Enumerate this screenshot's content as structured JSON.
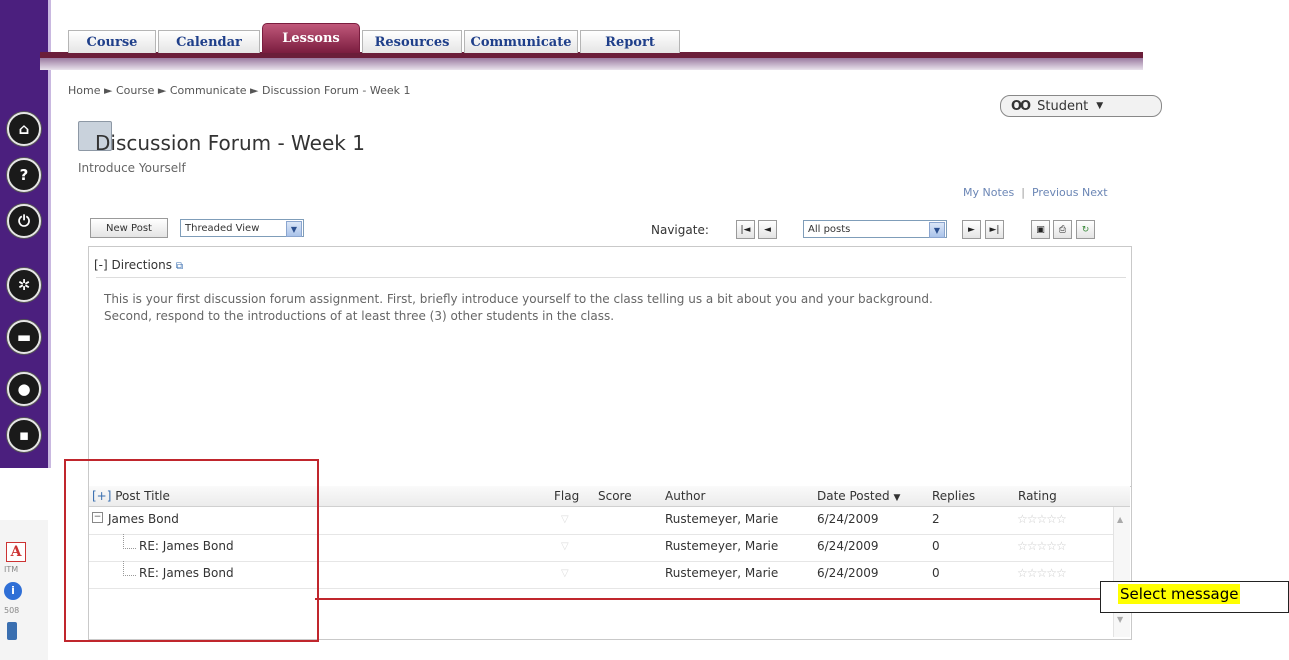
{
  "tabs": [
    "Course",
    "Calendar",
    "Lessons",
    "Resources",
    "Communicate",
    "Report"
  ],
  "active_tab": "Lessons",
  "breadcrumb": [
    "Home",
    "Course",
    "Communicate",
    "Discussion Forum - Week 1"
  ],
  "breadcrumb_sep": "►",
  "role_view": "Student",
  "page": {
    "title": "Discussion Forum - Week 1",
    "subtitle": "Introduce Yourself"
  },
  "top_links": {
    "my_notes": "My Notes",
    "previous": "Previous",
    "next": "Next"
  },
  "toolbar": {
    "new_post": "New Post",
    "view_select": "Threaded View",
    "navigate_label": "Navigate:",
    "filter_select": "All posts"
  },
  "directions": {
    "toggle": "[-] Directions",
    "text": "This is your first discussion forum assignment.  First, briefly introduce yourself to the class telling us a bit about you and your background.  Second, respond to the introductions of at least three (3) other students in the class."
  },
  "grid": {
    "expand_toggle": "[+]",
    "columns": [
      "Post Title",
      "Flag",
      "Score",
      "Author",
      "Date Posted",
      "Replies",
      "Rating"
    ],
    "rows": [
      {
        "title": "James Bond",
        "flag": "",
        "score": "",
        "author": "Rustemeyer, Marie",
        "date": "6/24/2009",
        "replies": "2",
        "level": 0
      },
      {
        "title": "RE: James Bond",
        "flag": "",
        "score": "",
        "author": "Rustemeyer, Marie",
        "date": "6/24/2009",
        "replies": "0",
        "level": 1
      },
      {
        "title": "RE: James Bond",
        "flag": "",
        "score": "",
        "author": "Rustemeyer, Marie",
        "date": "6/24/2009",
        "replies": "0",
        "level": 1
      }
    ]
  },
  "sidebar_bottom": {
    "itm": "ITM",
    "s508": "508"
  },
  "callout": "Select message",
  "colors": {
    "rail": "#4b1f7e",
    "active_tab": "#7a1d3f",
    "annotation_red": "#c0262d",
    "highlight": "#ffff00"
  }
}
